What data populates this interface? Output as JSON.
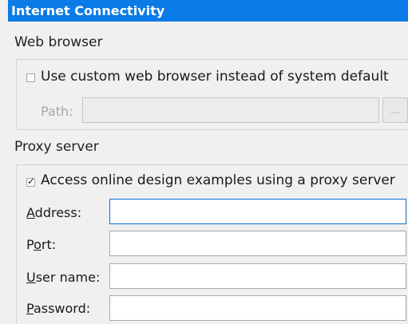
{
  "panel": {
    "title": "Internet Connectivity"
  },
  "web_browser": {
    "section_title": "Web browser",
    "custom_browser_checkbox": {
      "label": "Use custom web browser instead of system default",
      "checked": false
    },
    "path": {
      "label": "Path:",
      "value": "",
      "enabled": false
    },
    "browse_button_label": "..."
  },
  "proxy_server": {
    "section_title": "Proxy server",
    "use_proxy_checkbox": {
      "label": "Access online design examples using a proxy server",
      "checked": true
    },
    "fields": [
      {
        "label_mnemonic": "A",
        "label_rest": "ddress:",
        "value": ""
      },
      {
        "label_mnemonic_prefix": "P",
        "label_mnemonic": "o",
        "label_rest": "rt:",
        "value": ""
      },
      {
        "label_mnemonic": "U",
        "label_rest": "ser name:",
        "value": ""
      },
      {
        "label_mnemonic": "P",
        "label_rest": "assword:",
        "value": ""
      }
    ]
  },
  "colors": {
    "title_bar": "#0a7be6",
    "background": "#f0f0f0",
    "focus_border": "#0a6fd8"
  }
}
